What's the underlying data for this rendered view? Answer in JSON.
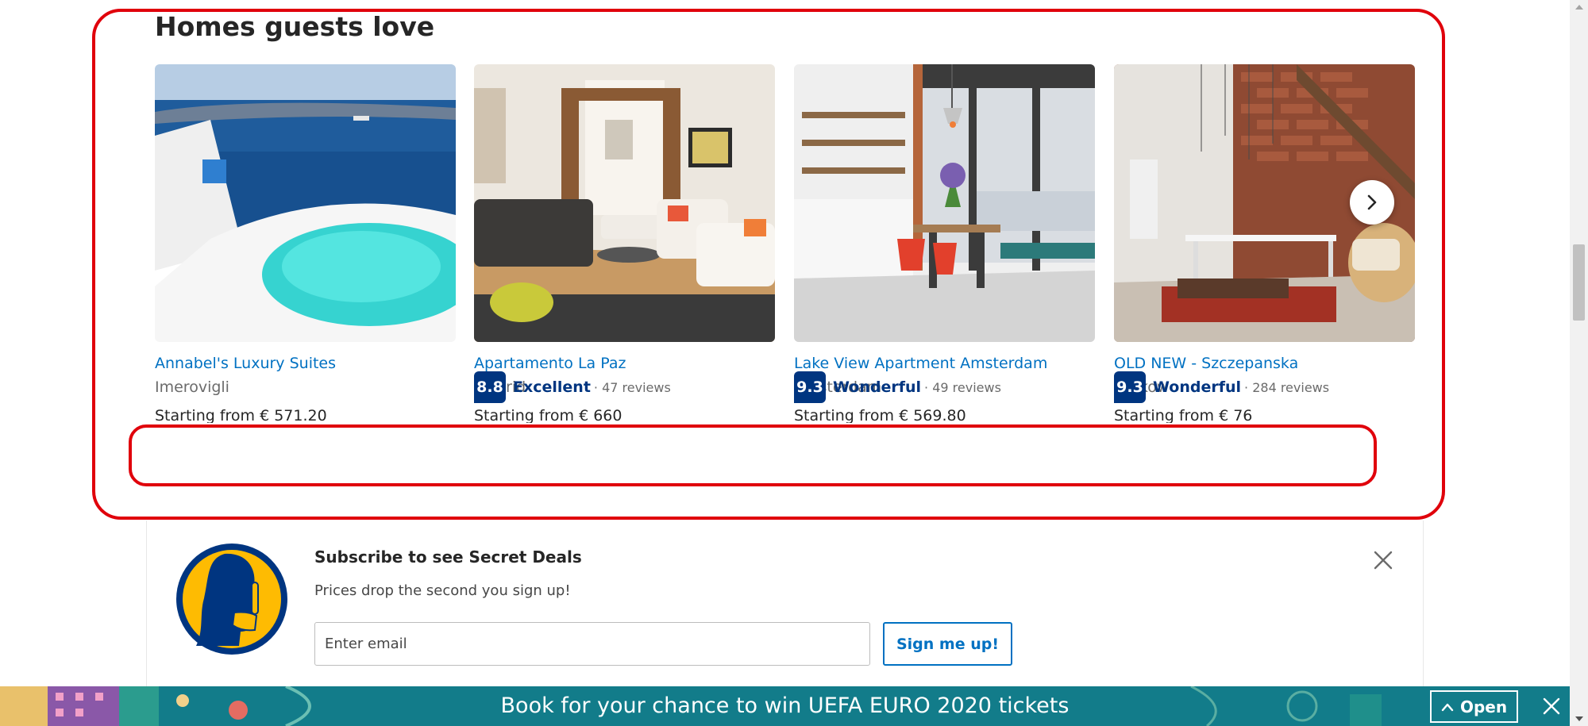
{
  "section": {
    "title": "Homes guests love"
  },
  "cards": [
    {
      "name": "Annabel's Luxury Suites",
      "city": "Imerovigli",
      "price": "Starting from € 571.20"
    },
    {
      "name": "Apartamento La Paz",
      "city": "Madrid",
      "price": "Starting from € 660",
      "score": "8.8",
      "score_word": "Excellent",
      "reviews": "· 47 reviews"
    },
    {
      "name": "Lake View Apartment Amsterdam",
      "city": "Amsterdam",
      "price": "Starting from € 569.80",
      "score": "9.3",
      "score_word": "Wonderful",
      "reviews": "· 49 reviews"
    },
    {
      "name": "OLD NEW - Szczepanska",
      "city": "Krakow",
      "price": "Starting from € 76",
      "score": "9.3",
      "score_word": "Wonderful",
      "reviews": "· 284 reviews"
    }
  ],
  "carousel": {
    "next_icon": "chevron-right-icon"
  },
  "subscribe": {
    "title": "Subscribe to see Secret Deals",
    "text": "Prices drop the second you sign up!",
    "email_placeholder": "Enter email",
    "button": "Sign me up!",
    "close_icon": "close-icon"
  },
  "banner": {
    "text": "Book for your chance to win UEFA EURO 2020 tickets",
    "open_label": "Open",
    "close_icon": "close-icon"
  },
  "colors": {
    "link": "#0071c2",
    "score_bg": "#003580",
    "banner_bg": "#127c8a",
    "annotation": "#e0000b"
  }
}
